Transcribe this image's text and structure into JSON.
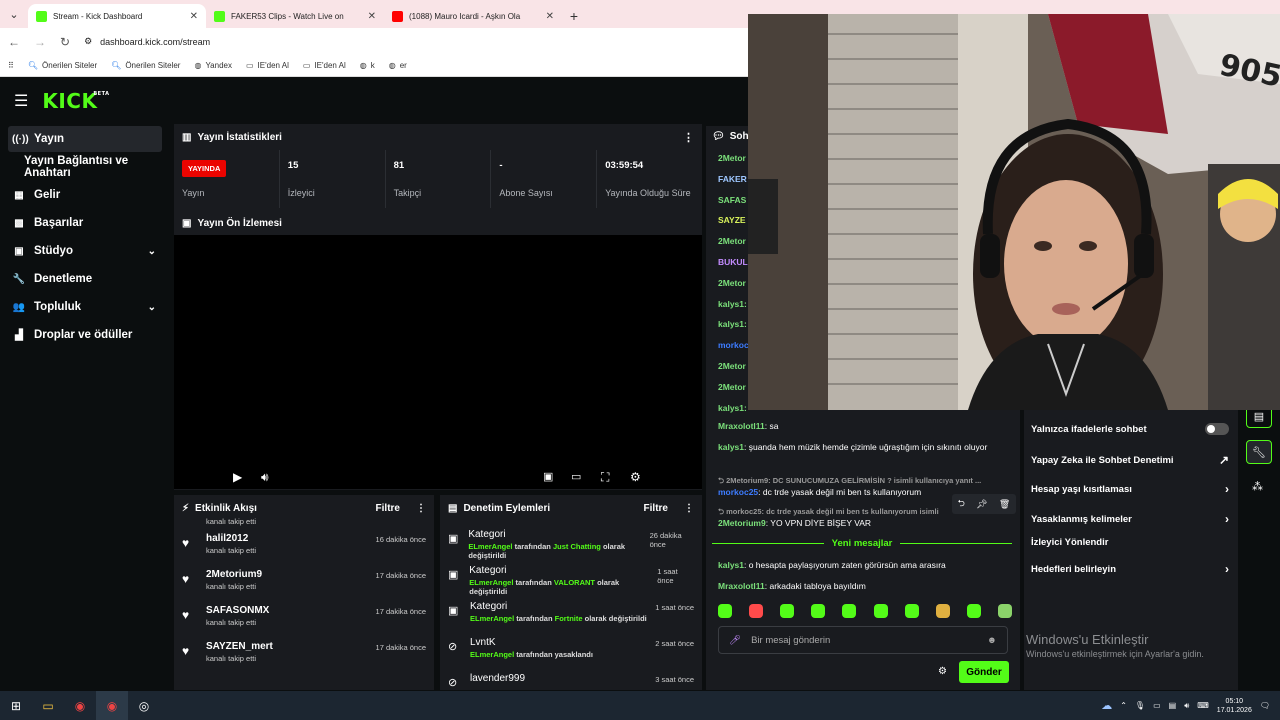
{
  "browser": {
    "tabs": [
      {
        "title": "Stream - Kick Dashboard",
        "color": "#53fc18",
        "active": true
      },
      {
        "title": "FAKER53 Clips - Watch Live on",
        "color": "#53fc18",
        "active": false
      },
      {
        "title": "(1088) Mauro Icardi - Aşkın Ola",
        "color": "#ff0000",
        "active": false
      }
    ],
    "url": "dashboard.kick.com/stream",
    "bookmarks": [
      "Önerilen Siteler",
      "Önerilen Siteler",
      "Yandex",
      "IE'den Al",
      "IE'den Al",
      "k",
      "er"
    ]
  },
  "kick": {
    "logo": "KICK",
    "logo_tag": "BETA",
    "nav": [
      {
        "label": "Yayın",
        "icon": "broadcast-icon",
        "glyph": "((·))",
        "active": true,
        "chevron": false
      },
      {
        "label": "Yayın Bağlantısı ve Anahtarı",
        "icon": "",
        "glyph": "",
        "active": false,
        "chevron": false
      },
      {
        "label": "Gelir",
        "icon": "revenue-icon",
        "glyph": "▦",
        "active": false,
        "chevron": false
      },
      {
        "label": "Başarılar",
        "icon": "achievements-icon",
        "glyph": "▩",
        "active": false,
        "chevron": false
      },
      {
        "label": "Stüdyo",
        "icon": "studio-icon",
        "glyph": "▣",
        "active": false,
        "chevron": true
      },
      {
        "label": "Denetleme",
        "icon": "wrench-icon",
        "glyph": "🔧",
        "active": false,
        "chevron": false
      },
      {
        "label": "Topluluk",
        "icon": "community-icon",
        "glyph": "👥",
        "active": false,
        "chevron": true
      },
      {
        "label": "Droplar ve ödüller",
        "icon": "drops-icon",
        "glyph": "▟",
        "active": false,
        "chevron": false
      }
    ],
    "stats_panel": {
      "title": "Yayın İstatistikleri",
      "live_badge": "YAYINDA",
      "items": [
        {
          "value": "",
          "label": "Yayın"
        },
        {
          "value": "15",
          "label": "İzleyici"
        },
        {
          "value": "81",
          "label": "Takipçi"
        },
        {
          "value": "-",
          "label": "Abone Sayısı"
        },
        {
          "value": "03:59:54",
          "label": "Yayında Olduğu Süre"
        }
      ]
    },
    "preview_title": "Yayın Ön İzlemesi",
    "activity": {
      "title": "Etkinlik Akışı",
      "filter": "Filtre",
      "partial": "kanalı takip etti",
      "items": [
        {
          "name": "halil2012",
          "sub": "kanalı takip etti",
          "time": "16 dakika önce"
        },
        {
          "name": "2Metorium9",
          "sub": "kanalı takip etti",
          "time": "17 dakika önce"
        },
        {
          "name": "SAFASONMX",
          "sub": "kanalı takip etti",
          "time": "17 dakika önce"
        },
        {
          "name": "SAYZEN_mert",
          "sub": "kanalı takip etti",
          "time": "17 dakika önce"
        }
      ]
    },
    "moderation": {
      "title": "Denetim Eylemleri",
      "filter": "Filtre",
      "items": [
        {
          "name": "Kategori",
          "actor": "ELmerAngel",
          "mid": " tarafından ",
          "target": "Just Chatting",
          "tail": " olarak değiştirildi",
          "time": "26 dakika önce"
        },
        {
          "name": "Kategori",
          "actor": "ELmerAngel",
          "mid": " tarafından ",
          "target": "VALORANT",
          "tail": " olarak değiştirildi",
          "time": "1 saat önce"
        },
        {
          "name": "Kategori",
          "actor": "ELmerAngel",
          "mid": " tarafından ",
          "target": "Fortnite",
          "tail": " olarak değiştirildi",
          "time": "1 saat önce"
        },
        {
          "name": "LvntK",
          "actor": "ELmerAngel",
          "mid": " tarafından yasaklandı",
          "target": "",
          "tail": "",
          "time": "2 saat önce"
        },
        {
          "name": "lavender999",
          "actor": "",
          "mid": "",
          "target": "",
          "tail": "",
          "time": "3 saat önce"
        }
      ]
    },
    "chat": {
      "title": "Sohbet",
      "names": [
        {
          "name": "2Metor",
          "color": "#7be07b"
        },
        {
          "name": "FAKER",
          "color": "#9ec7ff"
        },
        {
          "name": "SAFAS",
          "color": "#7be07b"
        },
        {
          "name": "SAYZE",
          "color": "#d9f35c"
        },
        {
          "name": "2Metor",
          "color": "#7be07b"
        },
        {
          "name": "BUKUL",
          "color": "#c38cff"
        },
        {
          "name": "2Metor",
          "color": "#7be07b"
        },
        {
          "name": "kalys1:",
          "color": "#7be07b"
        },
        {
          "name": "kalys1:",
          "color": "#7be07b"
        },
        {
          "name": "morkoc",
          "color": "#3d7cff"
        },
        {
          "name": "2Metor",
          "color": "#7be07b"
        },
        {
          "name": "2Metor",
          "color": "#7be07b"
        },
        {
          "name": "kalys1:",
          "color": "#7be07b"
        }
      ],
      "messages": [
        {
          "user": "Mraxolotl11",
          "color": "#7be07b",
          "text": ": sa"
        },
        {
          "user": "kalys1",
          "color": "#7be07b",
          "text": ": şuanda hem müzik hemde çizimle uğraştığım için sıkınıtı oluyor"
        }
      ],
      "reply1": "2Metorium9: DC SUNUCUMUZA GELİRMİSİN ? isimli kullanıcıya yanıt ...",
      "msg3": {
        "user": "morkoc25",
        "color": "#3d7cff",
        "text": ": dc trde yasak değil mi ben ts kullanıyorum"
      },
      "reply2": "morkoc25: dc trde yasak değil mi ben ts kullanıyorum isimli",
      "msg4": {
        "user": "2Metorium9",
        "color": "#7be07b",
        "text": ": YO VPN DİYE BİŞEY VAR"
      },
      "new_messages": "Yeni mesajlar",
      "msg5": {
        "user": "kalys1",
        "color": "#7be07b",
        "text": ": o hesapta paylaşıyorum zaten görürsün ama arasıra"
      },
      "msg6": {
        "user": "Mraxolotl11",
        "color": "#7be07b",
        "text": ": arkadaki tabloya bayıldım"
      },
      "emote_colors": [
        "#53fc18",
        "#ff4b4b",
        "#53fc18",
        "#53fc18",
        "#53fc18",
        "#53fc18",
        "#53fc18",
        "#e0b040",
        "#53fc18",
        "#8bd36a"
      ],
      "input_placeholder": "Bir mesaj gönderin",
      "send": "Gönder"
    },
    "chat_settings": {
      "items": [
        {
          "label": "Yalnızca ifadelerle sohbet",
          "right": "toggle"
        },
        {
          "label": "Yapay Zeka ile Sohbet Denetimi",
          "right": "↗"
        },
        {
          "label": "Hesap yaşı kısıtlaması",
          "right": "›"
        },
        {
          "label": "Yasaklanmış kelimeler",
          "right": "›"
        },
        {
          "label": "İzleyici Yönlendir",
          "right": ""
        },
        {
          "label": "Hedefleri belirleyin",
          "right": "›"
        }
      ]
    },
    "watermark": {
      "line1": "Windows'u Etkinleştir",
      "line2": "Windows'u etkinleştirmek için Ayarlar'a gidin."
    }
  },
  "taskbar": {
    "time": "05:10",
    "date": "17.01.2026"
  }
}
